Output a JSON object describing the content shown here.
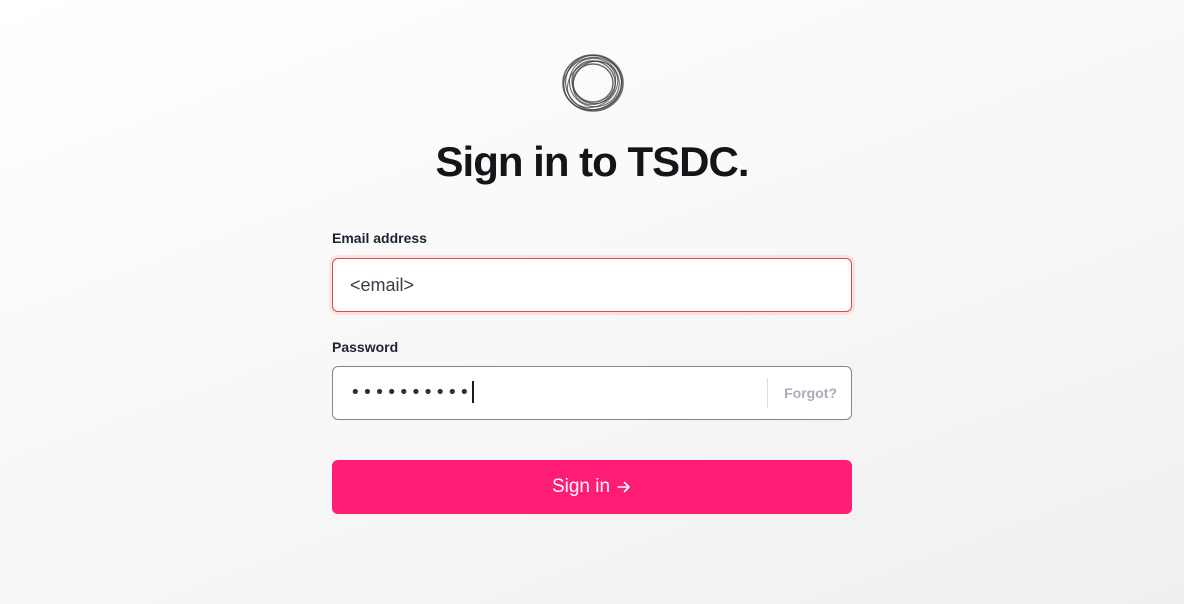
{
  "brand": {
    "logo_icon": "ring-logo-icon",
    "heading": "Sign in to TSDC."
  },
  "form": {
    "email": {
      "label": "Email address",
      "value": "<email>",
      "border_color": "#e8434f"
    },
    "password": {
      "label": "Password",
      "masked_value": "••••••••••",
      "forgot_label": "Forgot?"
    },
    "submit": {
      "label": "Sign in",
      "icon": "arrow-right-icon",
      "background_color": "#ff1c74"
    }
  }
}
